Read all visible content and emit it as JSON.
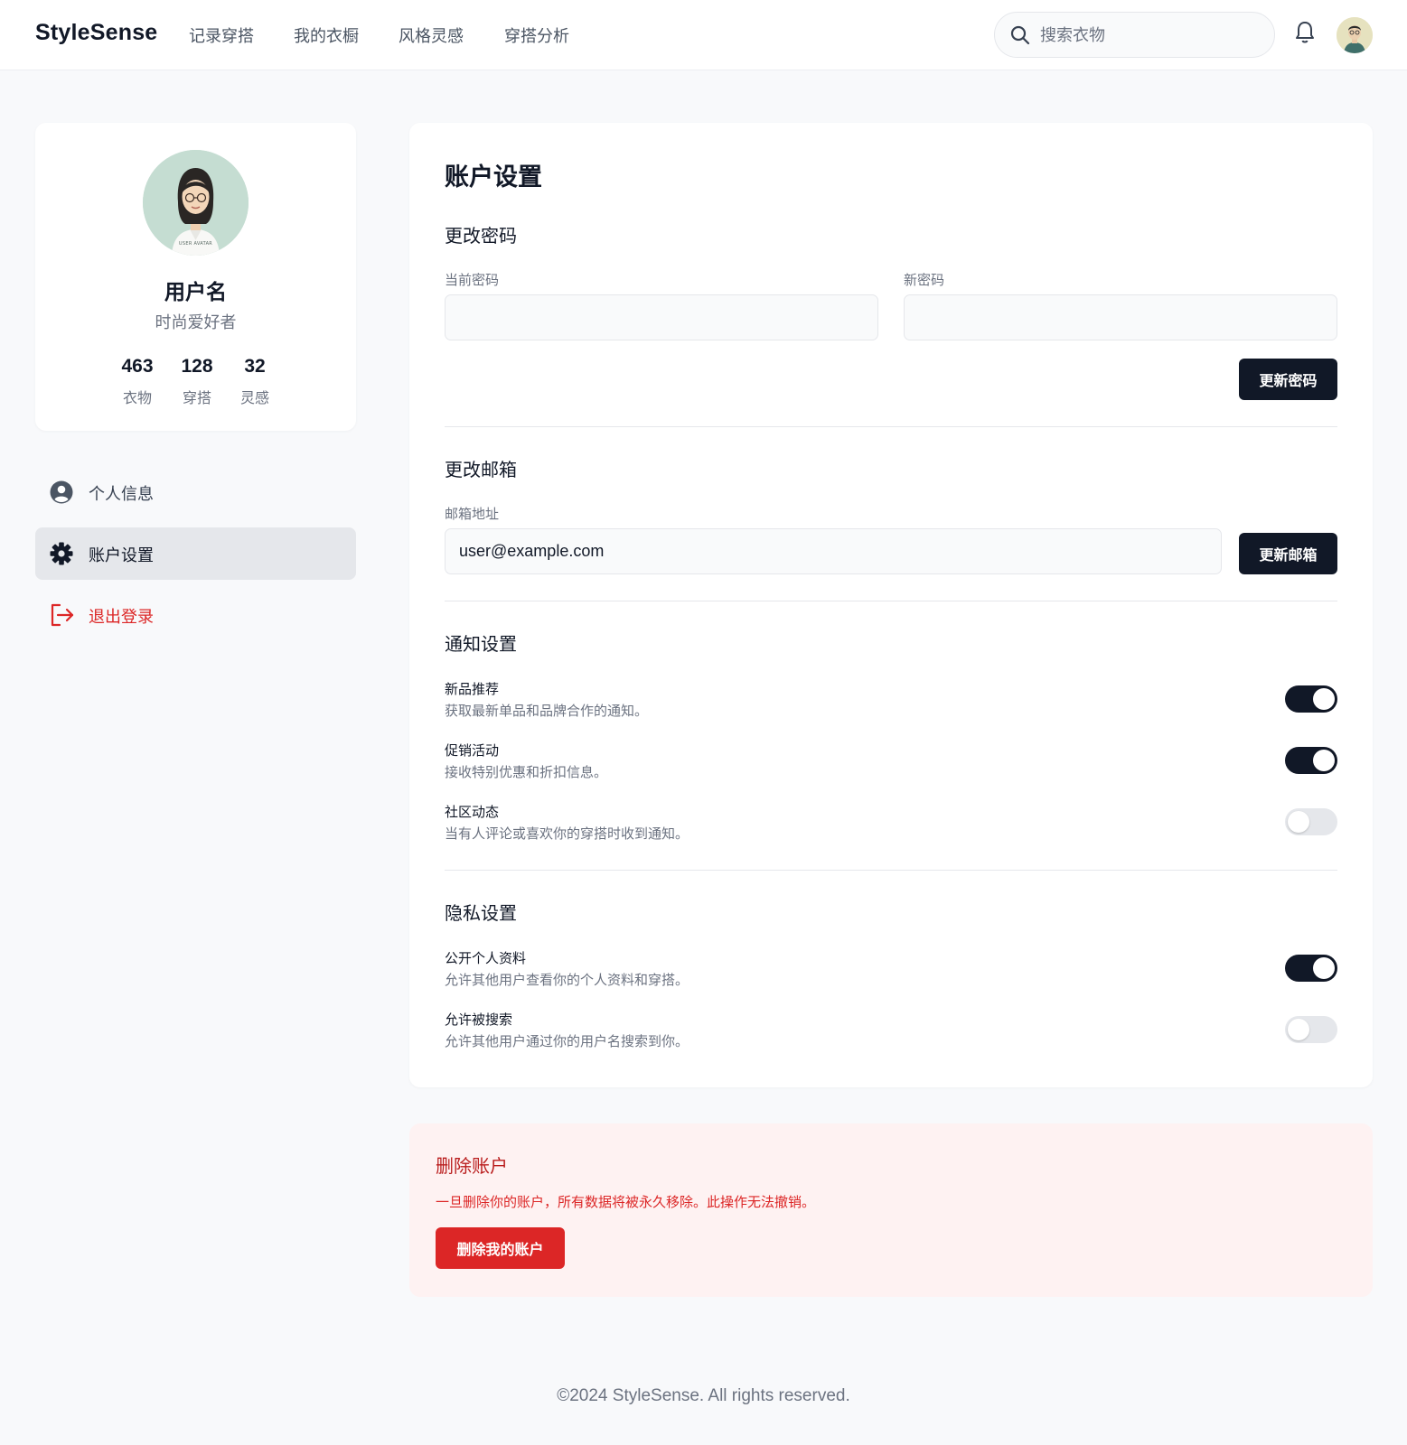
{
  "header": {
    "logo": "StyleSense",
    "nav": [
      "记录穿搭",
      "我的衣橱",
      "风格灵感",
      "穿搭分析"
    ],
    "search_placeholder": "搜索衣物"
  },
  "profile": {
    "avatar_caption": "USER AVATAR",
    "name": "用户名",
    "tagline": "时尚爱好者",
    "stats": [
      {
        "value": "463",
        "label": "衣物"
      },
      {
        "value": "128",
        "label": "穿搭"
      },
      {
        "value": "32",
        "label": "灵感"
      }
    ]
  },
  "sidebar": {
    "items": [
      {
        "label": "个人信息",
        "icon": "user-circle-icon"
      },
      {
        "label": "账户设置",
        "icon": "gear-icon",
        "active": true
      },
      {
        "label": "退出登录",
        "icon": "logout-icon"
      }
    ]
  },
  "settings": {
    "title": "账户设置",
    "password": {
      "title": "更改密码",
      "current_label": "当前密码",
      "current_value": "",
      "new_label": "新密码",
      "new_value": "",
      "button": "更新密码"
    },
    "email": {
      "title": "更改邮箱",
      "label": "邮箱地址",
      "value": "user@example.com",
      "button": "更新邮箱"
    },
    "notifications": {
      "title": "通知设置",
      "options": [
        {
          "title": "新品推荐",
          "desc": "获取最新单品和品牌合作的通知。",
          "enabled": true
        },
        {
          "title": "促销活动",
          "desc": "接收特别优惠和折扣信息。",
          "enabled": true
        },
        {
          "title": "社区动态",
          "desc": "当有人评论或喜欢你的穿搭时收到通知。",
          "enabled": false
        }
      ]
    },
    "privacy": {
      "title": "隐私设置",
      "options": [
        {
          "title": "公开个人资料",
          "desc": "允许其他用户查看你的个人资料和穿搭。",
          "enabled": true
        },
        {
          "title": "允许被搜索",
          "desc": "允许其他用户通过你的用户名搜索到你。",
          "enabled": false
        }
      ]
    }
  },
  "danger": {
    "title": "删除账户",
    "text": "一旦删除你的账户，所有数据将被永久移除。此操作无法撤销。",
    "button": "删除我的账户"
  },
  "footer": "©2024 StyleSense. All rights reserved.",
  "colors": {
    "primary": "#111827",
    "danger": "#dc2626",
    "danger_bg": "#fef2f2",
    "page_bg": "#f8f9fb",
    "toggle_off": "#e5e7eb"
  }
}
